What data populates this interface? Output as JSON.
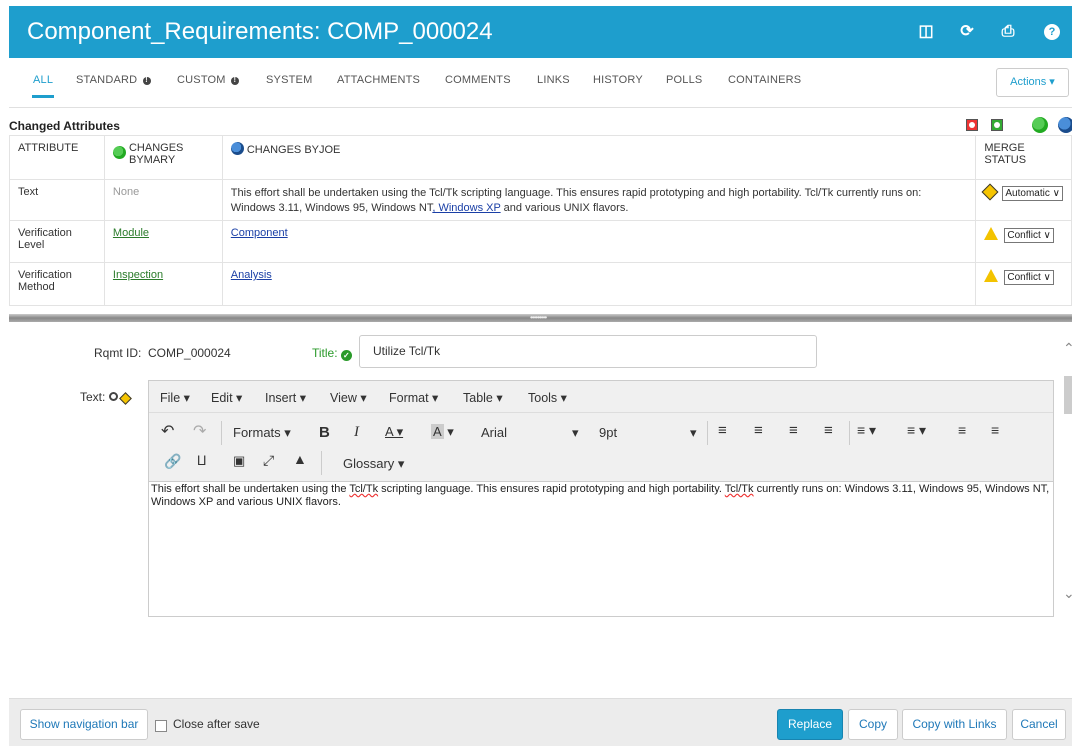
{
  "header": {
    "title": "Component_Requirements: COMP_000024",
    "icons": [
      "binoculars-icon",
      "refresh-icon",
      "print-icon",
      "help-icon"
    ]
  },
  "tabs": [
    {
      "label": "ALL",
      "active": true
    },
    {
      "label": "STANDARD",
      "info": true
    },
    {
      "label": "CUSTOM",
      "info": true
    },
    {
      "label": "SYSTEM"
    },
    {
      "label": "ATTACHMENTS"
    },
    {
      "label": "COMMENTS"
    },
    {
      "label": "LINKS"
    },
    {
      "label": "HISTORY"
    },
    {
      "label": "POLLS"
    },
    {
      "label": "CONTAINERS"
    }
  ],
  "actions_label": "Actions ▾",
  "changed": {
    "title": "Changed Attributes",
    "headers": {
      "attribute": "ATTRIBUTE",
      "changes_mary": "CHANGES BYMARY",
      "changes_joe": "CHANGES BYJOE",
      "merge_status": "MERGE STATUS"
    },
    "rows": [
      {
        "attribute": "Text",
        "mary": "None",
        "joe_pre": "This effort shall be undertaken using the Tcl/Tk scripting language. This ensures rapid prototyping and high portability. Tcl/Tk currently runs on: Windows 3.11, Windows 95, Windows NT",
        "joe_link": ", Windows XP",
        "joe_post": " and various UNIX flavors.",
        "status": "Automatic"
      },
      {
        "attribute": "Verification Level",
        "mary": "Module",
        "joe": "Component",
        "status": "Conflict"
      },
      {
        "attribute": "Verification Method",
        "mary": "Inspection",
        "joe": "Analysis",
        "status": "Conflict"
      }
    ]
  },
  "form": {
    "rqmt_label": "Rqmt ID:",
    "rqmt_value": "COMP_000024",
    "title_label": "Title:",
    "title_value": "Utilize Tcl/Tk",
    "text_label": "Text:"
  },
  "editor": {
    "menus": [
      "File ▾",
      "Edit ▾",
      "Insert ▾",
      "View ▾",
      "Format ▾",
      "Table ▾",
      "Tools ▾"
    ],
    "formats": "Formats ▾",
    "font": "Arial",
    "size": "9pt",
    "glossary": "Glossary ▾",
    "body_pre": "This effort shall be undertaken using the ",
    "body_spell1": "Tcl/Tk",
    "body_mid": " scripting language. This ensures rapid prototyping and high portability. ",
    "body_spell2": "Tcl/Tk",
    "body_post": " currently runs on: Windows 3.11, Windows 95, Windows NT, Windows XP and various UNIX flavors."
  },
  "footer": {
    "nav": "Show navigation bar",
    "close_after_save": "Close after save",
    "replace": "Replace",
    "copy": "Copy",
    "copy_links": "Copy with Links",
    "cancel": "Cancel"
  }
}
